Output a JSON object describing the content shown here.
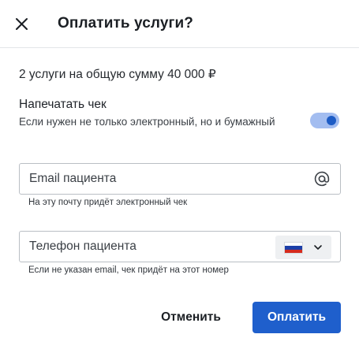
{
  "dialog": {
    "title": "Оплатить услуги?",
    "close_icon": "close-icon"
  },
  "summary": {
    "text": "2 услуги на общую сумму 40 000 ₽"
  },
  "receipt": {
    "label": "Напечатать чек",
    "hint": "Если нужен не только электронный, но и бумажный",
    "toggle_on": true
  },
  "email": {
    "placeholder": "Email пациента",
    "value": "",
    "icon": "at-sign-icon",
    "hint": "На эту почту придёт электронный чек"
  },
  "phone": {
    "placeholder": "Телефон пациента",
    "value": "",
    "country_flag": "russia-flag-icon",
    "dropdown_icon": "chevron-down-icon",
    "hint": "Если не указан email, чек придёт на этот номер"
  },
  "actions": {
    "cancel_label": "Отменить",
    "pay_label": "Оплатить"
  },
  "colors": {
    "accent": "#1f5fcc",
    "toggle_track": "#a3bdf0",
    "toggle_knob": "#1d5cc5",
    "border": "#b9bec4"
  }
}
